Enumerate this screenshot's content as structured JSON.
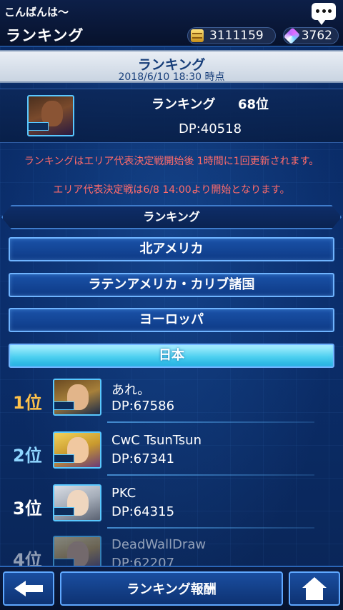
{
  "header": {
    "greeting": "こんばんは〜",
    "title": "ランキング",
    "gold": "3111159",
    "gems": "3762"
  },
  "band": {
    "title": "ランキング",
    "date": "2018/6/10 18:30 時点"
  },
  "my_ranking": {
    "label": "ランキング",
    "rank": "68位",
    "dp": "DP:40518"
  },
  "notices": [
    "ランキングはエリア代表決定戦開始後 1時間に1回更新されます。",
    "エリア代表決定戦は6/8 14:00より開始となります。"
  ],
  "category_header": "ランキング",
  "regions": [
    {
      "label": "北アメリカ",
      "selected": false
    },
    {
      "label": "ラテンアメリカ・カリブ諸国",
      "selected": false
    },
    {
      "label": "ヨーロッパ",
      "selected": false
    },
    {
      "label": "日本",
      "selected": true
    }
  ],
  "rankings": [
    {
      "rank": "1位",
      "name": "あれ。",
      "dp": "DP:67586",
      "color": "#ffc24a"
    },
    {
      "rank": "2位",
      "name": "CwC TsunTsun",
      "dp": "DP:67341",
      "color": "#8fd6ff"
    },
    {
      "rank": "3位",
      "name": "PKC",
      "dp": "DP:64315",
      "color": "#ffffff"
    },
    {
      "rank": "4位",
      "name": "DeadWallDraw",
      "dp": "DP:62207",
      "color": "#ffffff"
    }
  ],
  "bottom": {
    "reward_label": "ランキング報酬"
  }
}
